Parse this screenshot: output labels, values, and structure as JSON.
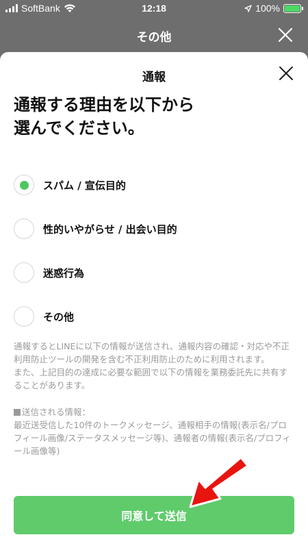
{
  "status_bar": {
    "carrier": "SoftBank",
    "time": "12:18",
    "battery_percent": "100%",
    "icons": [
      "signal-bars-icon",
      "wifi-icon",
      "location-arrow-icon",
      "battery-charging-icon"
    ]
  },
  "background_header": {
    "title": "その他"
  },
  "sheet": {
    "title": "通報",
    "heading": "通報する理由を以下から\n選んでください。",
    "options": [
      {
        "label": "スパム / 宣伝目的",
        "selected": true
      },
      {
        "label": "性的いやがらせ / 出会い目的",
        "selected": false
      },
      {
        "label": "迷惑行為",
        "selected": false
      },
      {
        "label": "その他",
        "selected": false
      }
    ],
    "notice": {
      "line1": "通報するとLINEに以下の情報が送信され、通報内容の確認・対応や不正利用防止ツールの開発を含む不正利用防止のために利用されます。",
      "line2": "また、上記目的の達成に必要な範囲で以下の情報を業務委託先に共有することがあります。",
      "sent_info_title": "送信される情報：",
      "sent_info_body": "最近送受信した10件のトークメッセージ、通報相手の情報(表示名/プロフィール画像/ステータスメッセージ等)、通報者の情報(表示名/プロフィール画像等)"
    },
    "submit_label": "同意して送信"
  },
  "colors": {
    "accent_green": "#4cc764",
    "button_green": "#5fcb6b",
    "arrow_red": "#e8140f",
    "overlay_gray": "#6e6e6e"
  }
}
